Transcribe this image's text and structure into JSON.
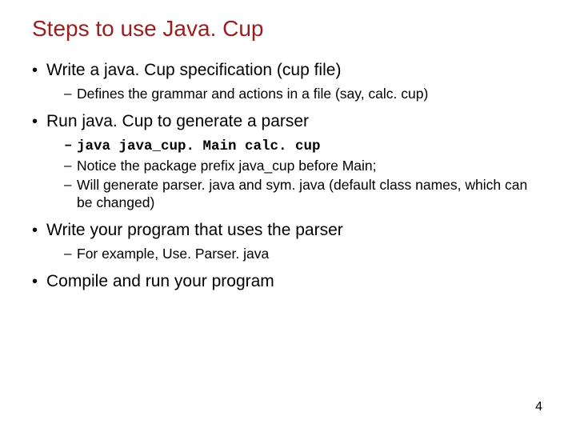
{
  "title": "Steps to use Java. Cup",
  "bullets": [
    {
      "text": "Write a java. Cup specification (cup file)",
      "sub": [
        {
          "text": "Defines the grammar and actions in a file (say, calc. cup)",
          "mono": false
        }
      ]
    },
    {
      "text": "Run java. Cup to generate a parser",
      "sub": [
        {
          "text": "java java_cup. Main calc. cup",
          "mono": true
        },
        {
          "text": "Notice the package prefix java_cup before Main;",
          "mono": false
        },
        {
          "text": "Will generate parser. java and sym. java (default class names, which can be changed)",
          "mono": false
        }
      ]
    },
    {
      "text": "Write your program that uses the parser",
      "sub": [
        {
          "text": "For example, Use. Parser. java",
          "mono": false
        }
      ]
    },
    {
      "text": "Compile and run your program",
      "sub": []
    }
  ],
  "pageNumber": "4"
}
